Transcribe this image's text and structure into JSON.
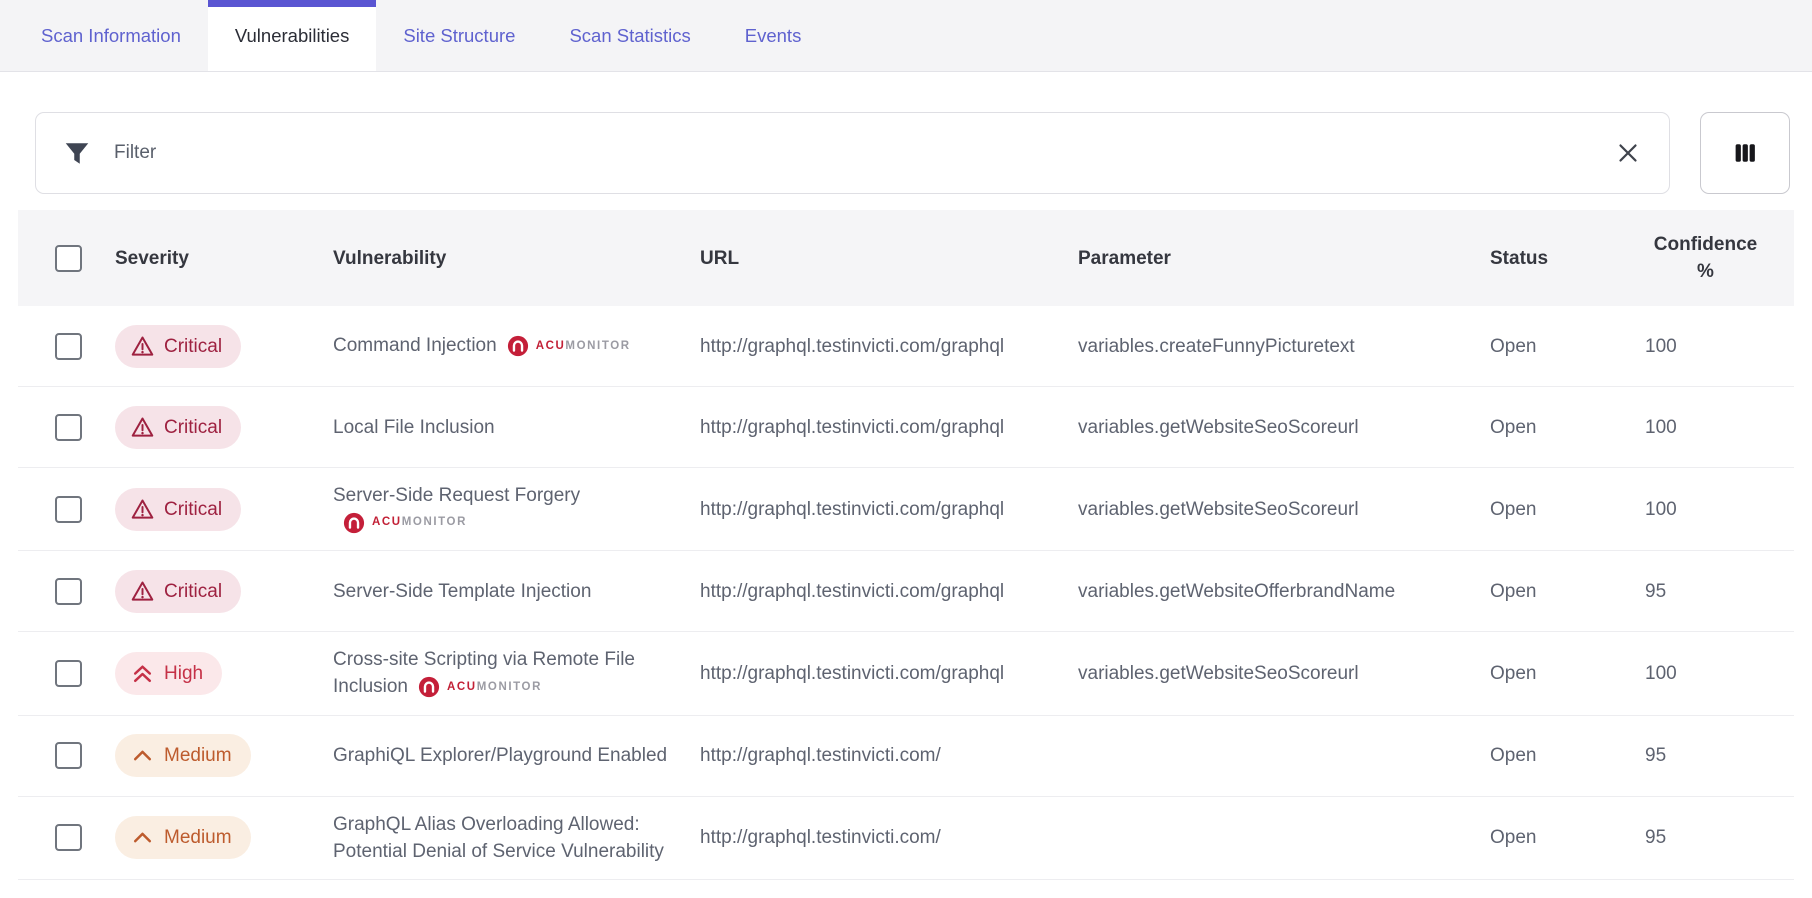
{
  "tabs": [
    {
      "label": "Scan Information",
      "active": false
    },
    {
      "label": "Vulnerabilities",
      "active": true
    },
    {
      "label": "Site Structure",
      "active": false
    },
    {
      "label": "Scan Statistics",
      "active": false
    },
    {
      "label": "Events",
      "active": false
    }
  ],
  "toolbar": {
    "filter_placeholder": "Filter",
    "filter_icon": "funnel-icon",
    "clear_icon": "clear-x-icon",
    "columns_button_icon": "columns-icon"
  },
  "table": {
    "headers": {
      "severity": "Severity",
      "vulnerability": "Vulnerability",
      "url": "URL",
      "parameter": "Parameter",
      "status": "Status",
      "confidence": "Confidence %"
    },
    "acumonitor_label_acu": "ACU",
    "acumonitor_label_monitor": "MONITOR",
    "rows": [
      {
        "severity": "Critical",
        "severity_class": "critical",
        "vulnerability": "Command Injection",
        "acumonitor": true,
        "url": "http://graphql.testinvicti.com/graphql",
        "parameter": "variables.createFunnyPicturetext",
        "status": "Open",
        "confidence": "100"
      },
      {
        "severity": "Critical",
        "severity_class": "critical",
        "vulnerability": "Local File Inclusion",
        "acumonitor": false,
        "url": "http://graphql.testinvicti.com/graphql",
        "parameter": "variables.getWebsiteSeoScoreurl",
        "status": "Open",
        "confidence": "100"
      },
      {
        "severity": "Critical",
        "severity_class": "critical",
        "vulnerability": "Server-Side Request Forgery",
        "acumonitor": true,
        "url": "http://graphql.testinvicti.com/graphql",
        "parameter": "variables.getWebsiteSeoScoreurl",
        "status": "Open",
        "confidence": "100"
      },
      {
        "severity": "Critical",
        "severity_class": "critical",
        "vulnerability": "Server-Side Template Injection",
        "acumonitor": false,
        "url": "http://graphql.testinvicti.com/graphql",
        "parameter": "variables.getWebsiteOfferbrandName",
        "status": "Open",
        "confidence": "95"
      },
      {
        "severity": "High",
        "severity_class": "high",
        "vulnerability": "Cross-site Scripting via Remote File Inclusion",
        "acumonitor": true,
        "url": "http://graphql.testinvicti.com/graphql",
        "parameter": "variables.getWebsiteSeoScoreurl",
        "status": "Open",
        "confidence": "100"
      },
      {
        "severity": "Medium",
        "severity_class": "medium",
        "vulnerability": "GraphiQL Explorer/Playground Enabled",
        "acumonitor": false,
        "url": "http://graphql.testinvicti.com/",
        "parameter": "",
        "status": "Open",
        "confidence": "95"
      },
      {
        "severity": "Medium",
        "severity_class": "medium",
        "vulnerability": "GraphQL Alias Overloading Allowed: Potential Denial of Service Vulnerability",
        "acumonitor": false,
        "url": "http://graphql.testinvicti.com/",
        "parameter": "",
        "status": "Open",
        "confidence": "95"
      }
    ]
  },
  "colors": {
    "tab_accent": "#5a55d2",
    "tab_text": "#5f62cf",
    "critical_text": "#9e2140",
    "critical_bg": "#f6e3e8",
    "high_text": "#c53147",
    "high_bg": "#fbe8ea",
    "medium_text": "#bd5b2d",
    "medium_bg": "#faeee2",
    "acumonitor_red": "#c22036",
    "header_bg": "#f5f5f7"
  }
}
